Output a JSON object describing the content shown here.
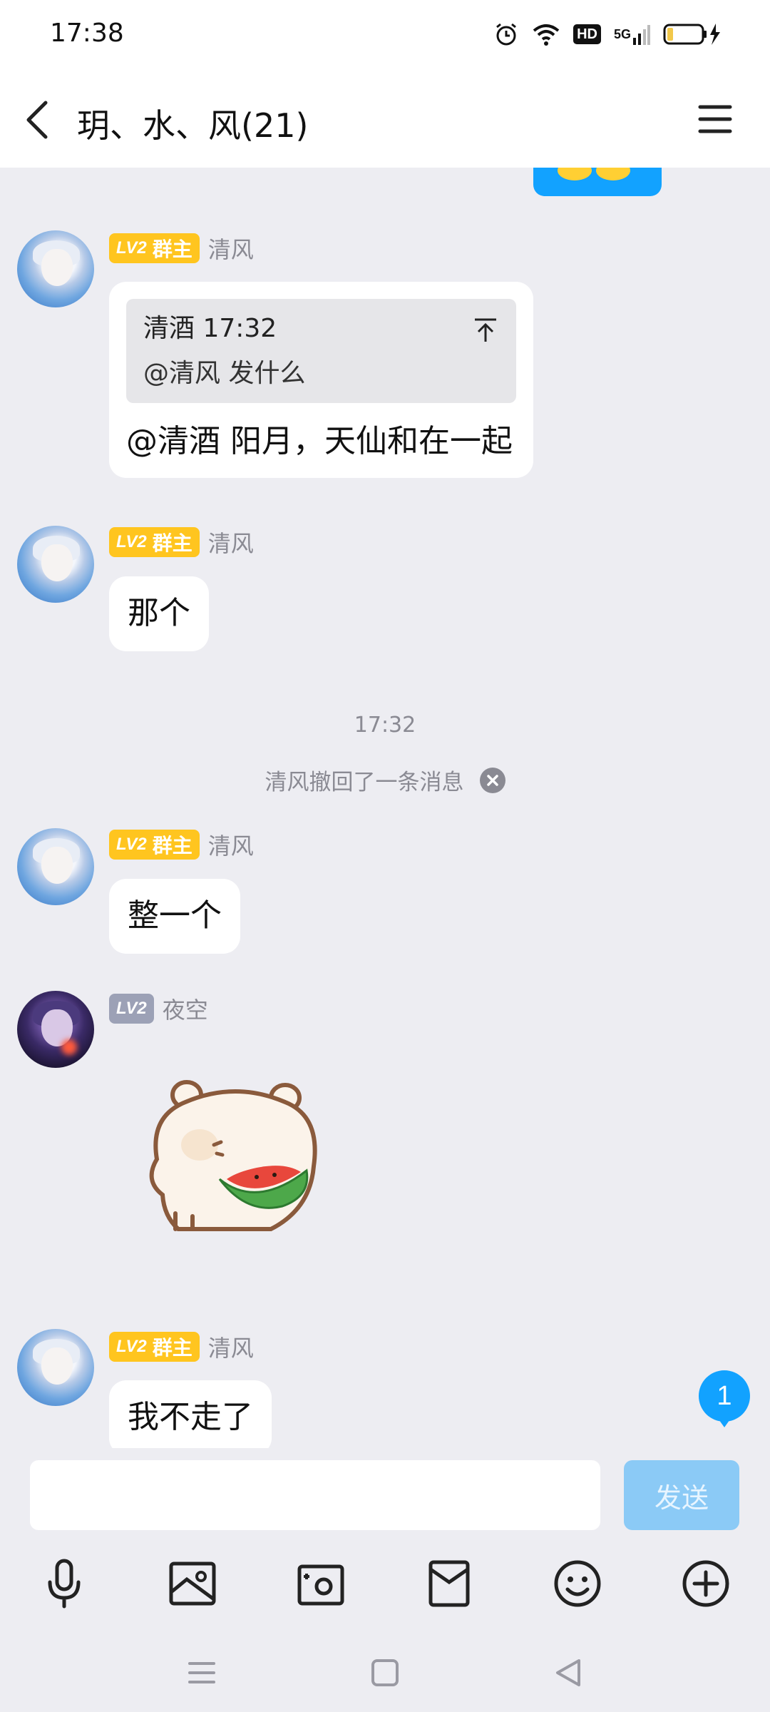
{
  "status_bar": {
    "time": "17:38",
    "hd_label": "HD",
    "network_label": "5G"
  },
  "header": {
    "title": "玥、水、风(21)"
  },
  "messages": [
    {
      "sender": "清风",
      "level": "LV2",
      "role": "群主",
      "quote": {
        "author": "清酒",
        "time": "17:32",
        "text": "@清风 发什么"
      },
      "text": "@清酒 阳月，天仙和在一起"
    },
    {
      "sender": "清风",
      "level": "LV2",
      "role": "群主",
      "text": "那个"
    },
    {
      "type": "timestamp",
      "text": "17:32"
    },
    {
      "type": "recall_notice",
      "text": "清风撤回了一条消息"
    },
    {
      "sender": "清风",
      "level": "LV2",
      "role": "群主",
      "text": "整一个"
    },
    {
      "sender": "夜空",
      "level": "LV2",
      "type": "sticker",
      "sticker": "hamster-eating-watermelon"
    },
    {
      "sender": "清风",
      "level": "LV2",
      "role": "群主",
      "text": "我不走了"
    }
  ],
  "unread_count": "1",
  "composer": {
    "input_value": "",
    "send_label": "发送"
  },
  "toolbar_icons": [
    "microphone-icon",
    "image-icon",
    "camera-icon",
    "red-packet-icon",
    "emoji-icon",
    "plus-circle-icon"
  ],
  "colors": {
    "accent": "#12a2ff",
    "owner_badge": "#ffc51f",
    "member_badge": "#9ca1b6",
    "send_disabled": "#8bcaf6"
  }
}
